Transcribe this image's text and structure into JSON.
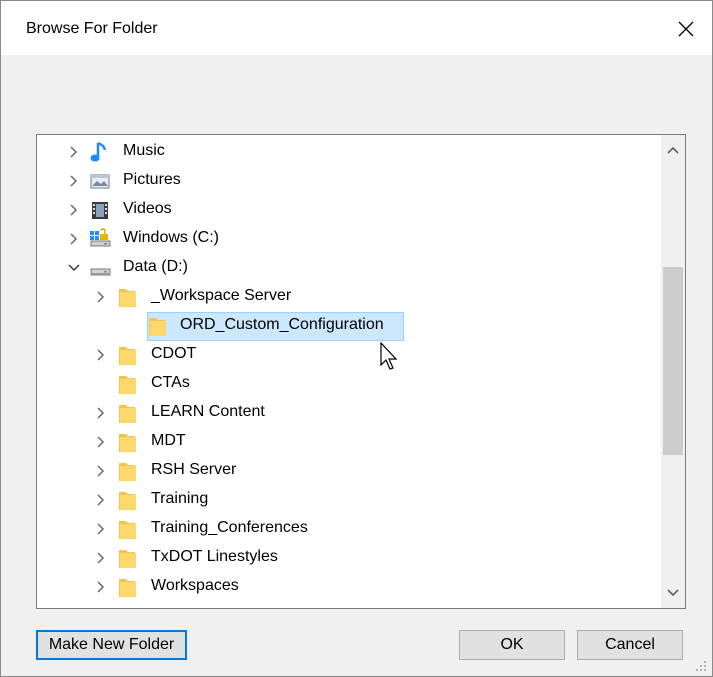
{
  "window": {
    "title": "Browse For Folder",
    "close_glyph": "✕"
  },
  "tree": {
    "items": [
      {
        "label": "Music",
        "icon": "music-note-icon",
        "expander": "collapsed",
        "level": 0
      },
      {
        "label": "Pictures",
        "icon": "pictures-icon",
        "expander": "collapsed",
        "level": 0
      },
      {
        "label": "Videos",
        "icon": "videos-icon",
        "expander": "collapsed",
        "level": 0
      },
      {
        "label": "Windows (C:)",
        "icon": "windows-drive-icon",
        "expander": "collapsed",
        "level": 0
      },
      {
        "label": "Data (D:)",
        "icon": "drive-icon",
        "expander": "expanded",
        "level": 0
      },
      {
        "label": "_Workspace Server",
        "icon": "folder-icon",
        "expander": "collapsed",
        "level": 1
      },
      {
        "label": "ORD_Custom_Configuration",
        "icon": "folder-icon",
        "expander": "none",
        "level": 2,
        "selected": true
      },
      {
        "label": "CDOT",
        "icon": "folder-icon",
        "expander": "collapsed",
        "level": 1
      },
      {
        "label": "CTAs",
        "icon": "folder-icon",
        "expander": "none",
        "level": 1
      },
      {
        "label": "LEARN Content",
        "icon": "folder-icon",
        "expander": "collapsed",
        "level": 1
      },
      {
        "label": "MDT",
        "icon": "folder-icon",
        "expander": "collapsed",
        "level": 1
      },
      {
        "label": "RSH Server",
        "icon": "folder-icon",
        "expander": "collapsed",
        "level": 1
      },
      {
        "label": "Training",
        "icon": "folder-icon",
        "expander": "collapsed",
        "level": 1
      },
      {
        "label": "Training_Conferences",
        "icon": "folder-icon",
        "expander": "collapsed",
        "level": 1
      },
      {
        "label": "TxDOT Linestyles",
        "icon": "folder-icon",
        "expander": "collapsed",
        "level": 1
      },
      {
        "label": "Workspaces",
        "icon": "folder-icon",
        "expander": "collapsed",
        "level": 1
      }
    ]
  },
  "buttons": {
    "make_new_folder": "Make New Folder",
    "ok": "OK",
    "cancel": "Cancel"
  },
  "colors": {
    "selection_bg": "#cce8ff",
    "selection_border": "#99d1ff",
    "focus_border": "#0078d7",
    "folder_fill": "#ffd86b",
    "music_blue": "#1a8cff"
  }
}
